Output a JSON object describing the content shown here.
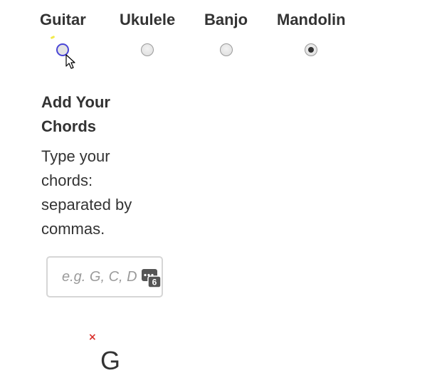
{
  "instruments": [
    {
      "label": "Guitar",
      "checked": false,
      "focused": true
    },
    {
      "label": "Ukulele",
      "checked": false,
      "focused": false
    },
    {
      "label": "Banjo",
      "checked": false,
      "focused": false
    },
    {
      "label": "Mandolin",
      "checked": true,
      "focused": false
    }
  ],
  "chords_section": {
    "heading": "Add Your Chords",
    "instructions": "Type your chords: separated by commas."
  },
  "chord_input": {
    "value": "",
    "placeholder": "e.g. G, C, D",
    "icon": "password-manager-icon",
    "badge_count": "6"
  },
  "result": {
    "mute_marker": "×",
    "chord_name": "G"
  },
  "colors": {
    "text": "#333333",
    "focus_ring": "#4a46d6",
    "mute_marker": "#d9302c"
  }
}
